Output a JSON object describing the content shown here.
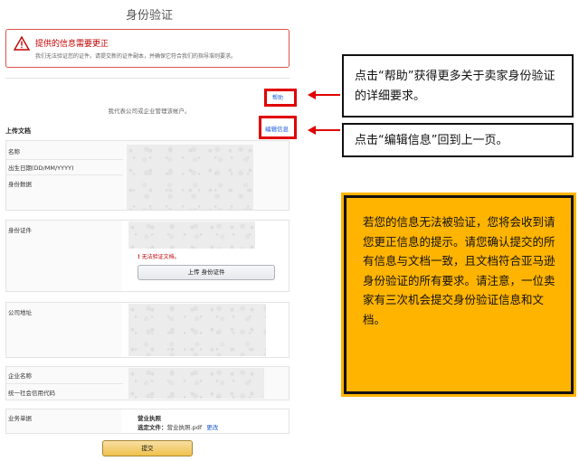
{
  "page": {
    "title": "身份验证"
  },
  "alert": {
    "title": "提供的信息需要更正",
    "text": "我们无法验证您的证件。请提交新的证件副本，并确保它符合我们的指导准则要求。"
  },
  "links": {
    "help": "帮助",
    "edit": "编辑信息"
  },
  "behalf_text": "我代表公司或企业管理该帐户。",
  "upload_label": "上传文档",
  "sections": {
    "identity": {
      "labels": [
        "名称",
        "出生日期(DD/MM/YYYY)",
        "身份数据"
      ]
    },
    "id_document": {
      "label": "身份证件",
      "error": "无法验证文档。",
      "upload_button": "上传 身份证件"
    },
    "company_address": {
      "label": "公司地址"
    },
    "business": {
      "labels": [
        "企业名称",
        "统一社会信用代码"
      ]
    },
    "documents": {
      "label": "业务单据",
      "doc_title": "营业执照",
      "selected_prefix": "选定文件：",
      "selected_file": "营业执照.pdf",
      "change_link": "更改"
    }
  },
  "submit_button": "提交",
  "callouts": {
    "help": "点击“帮助”获得更多关于卖家身份验证的详细要求。",
    "edit": "点击“编辑信息”回到上一页。"
  },
  "note": "若您的信息无法被验证，您将会收到请您更正信息的提示。请您确认提交的所有信息与文档一致，且文档符合亚马逊身份验证的所有要求。请注意，一位卖家有三次机会提交身份验证信息和文档。",
  "colors": {
    "error_red": "#c40000",
    "annotation_red": "#e00000",
    "note_bg": "#ffb400",
    "link_blue": "#1a5ad7"
  }
}
